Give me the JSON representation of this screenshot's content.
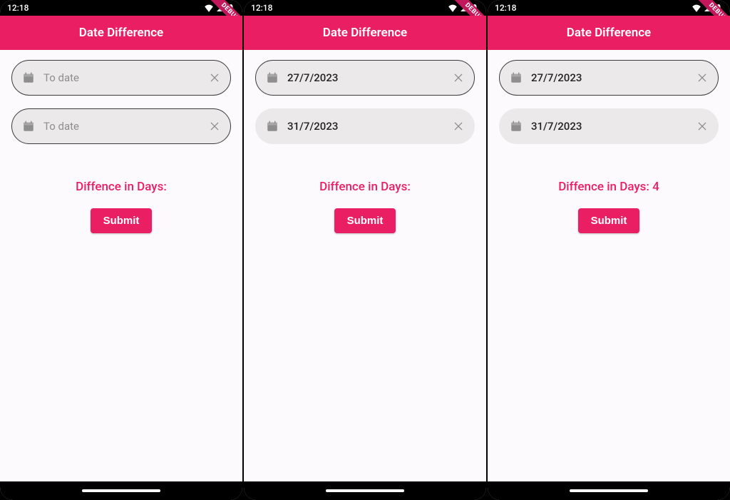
{
  "status": {
    "time": "12:18",
    "wifi_icon": "wifi",
    "signal_icon": "signal",
    "bell_icon": "bell"
  },
  "debug_label": "DEBUG",
  "appbar_title": "Date Difference",
  "placeholder_text": "To date",
  "result_prefix": "Diffence in Days:",
  "submit_label": "Submit",
  "colors": {
    "accent": "#e91e63",
    "field_bg": "#ebe9e9",
    "page_bg": "#fdfafd",
    "icon_muted": "#8e8e8e"
  },
  "screens": [
    {
      "from_value": "",
      "from_focused": true,
      "to_value": "",
      "to_focused": true,
      "result_suffix": ""
    },
    {
      "from_value": "27/7/2023",
      "from_focused": true,
      "to_value": "31/7/2023",
      "to_focused": false,
      "result_suffix": ""
    },
    {
      "from_value": "27/7/2023",
      "from_focused": true,
      "to_value": "31/7/2023",
      "to_focused": false,
      "result_suffix": " 4"
    }
  ]
}
